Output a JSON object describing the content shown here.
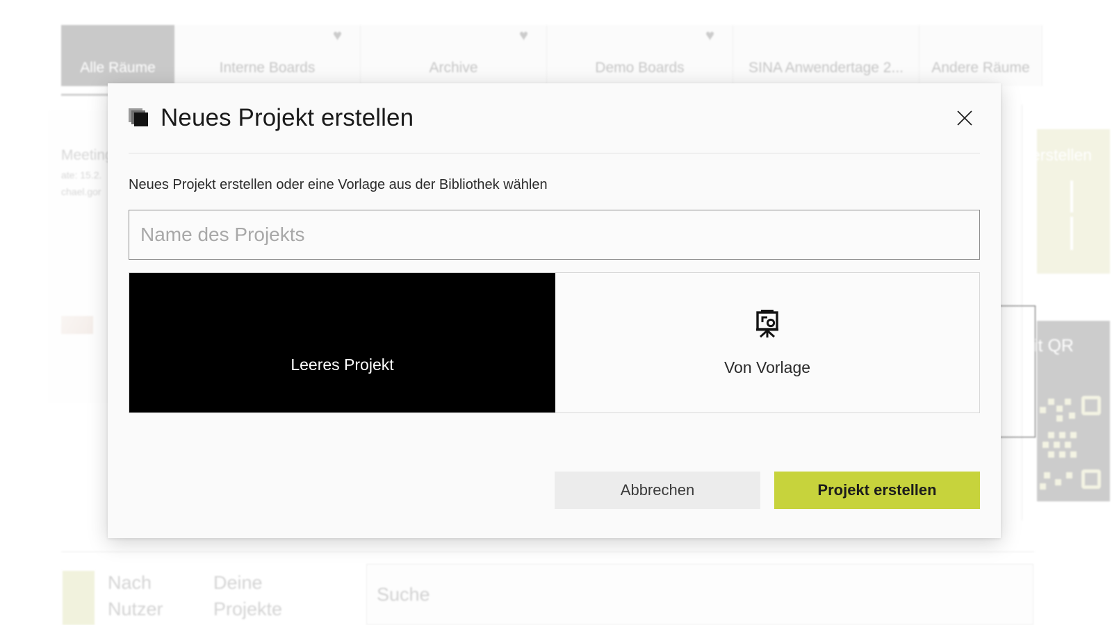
{
  "background": {
    "tabs": [
      {
        "label": "Alle Räume",
        "active": true,
        "favorite": false
      },
      {
        "label": "Interne Boards",
        "active": false,
        "favorite": true
      },
      {
        "label": "Archive",
        "active": false,
        "favorite": true
      },
      {
        "label": "Demo Boards",
        "active": false,
        "favorite": true
      },
      {
        "label": "SINA Anwendertage 2...",
        "active": false,
        "favorite": false
      },
      {
        "label": "Andere Räume",
        "active": false,
        "favorite": false
      }
    ],
    "favorite_icon": "♥",
    "left_card": {
      "title": "Meeting C",
      "date_line": "ate: 15.2.",
      "owner_line": "chael.gor"
    },
    "right_cards": {
      "create_label": "erstellen",
      "qr_label": "it QR"
    },
    "bottom": {
      "filter_user": "Nach\nNutzer",
      "filter_projects": "Deine\nProjekte",
      "search_placeholder": "Suche"
    }
  },
  "modal": {
    "icon": "layers-icon",
    "title": "Neues Projekt erstellen",
    "close_icon": "close-icon",
    "subtitle": "Neues Projekt erstellen oder eine Vorlage aus der Bibliothek wählen",
    "name_input": {
      "value": "",
      "placeholder": "Name des Projekts"
    },
    "options": [
      {
        "label": "Leeres Projekt",
        "selected": true,
        "icon": "none"
      },
      {
        "label": "Von Vorlage",
        "selected": false,
        "icon": "presentation-board-icon"
      }
    ],
    "buttons": {
      "cancel": "Abbrechen",
      "create": "Projekt erstellen"
    },
    "accent_color": "#c7d33c",
    "selected_tile_color": "#000000"
  }
}
